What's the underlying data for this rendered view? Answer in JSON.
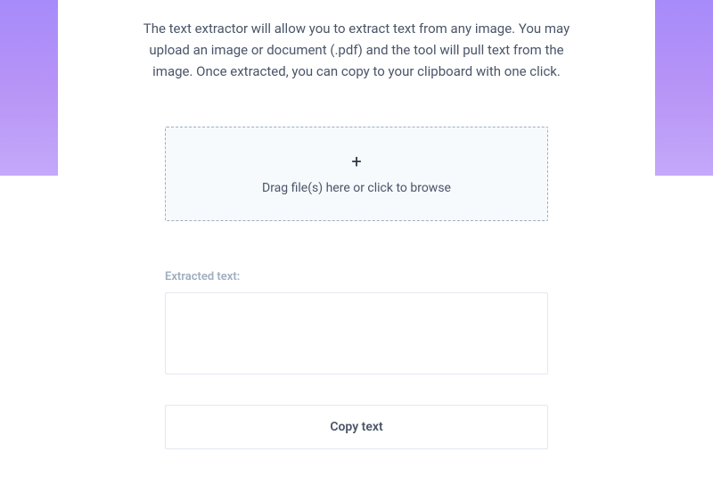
{
  "description": "The text extractor will allow you to extract text from any image. You may upload an image or document (.pdf) and the tool will pull text from the image. Once extracted, you can copy to your clipboard with one click.",
  "dropzone": {
    "icon": "+",
    "text": "Drag file(s) here or click to browse"
  },
  "extracted": {
    "label": "Extracted text:",
    "value": ""
  },
  "copy_button_label": "Copy text"
}
